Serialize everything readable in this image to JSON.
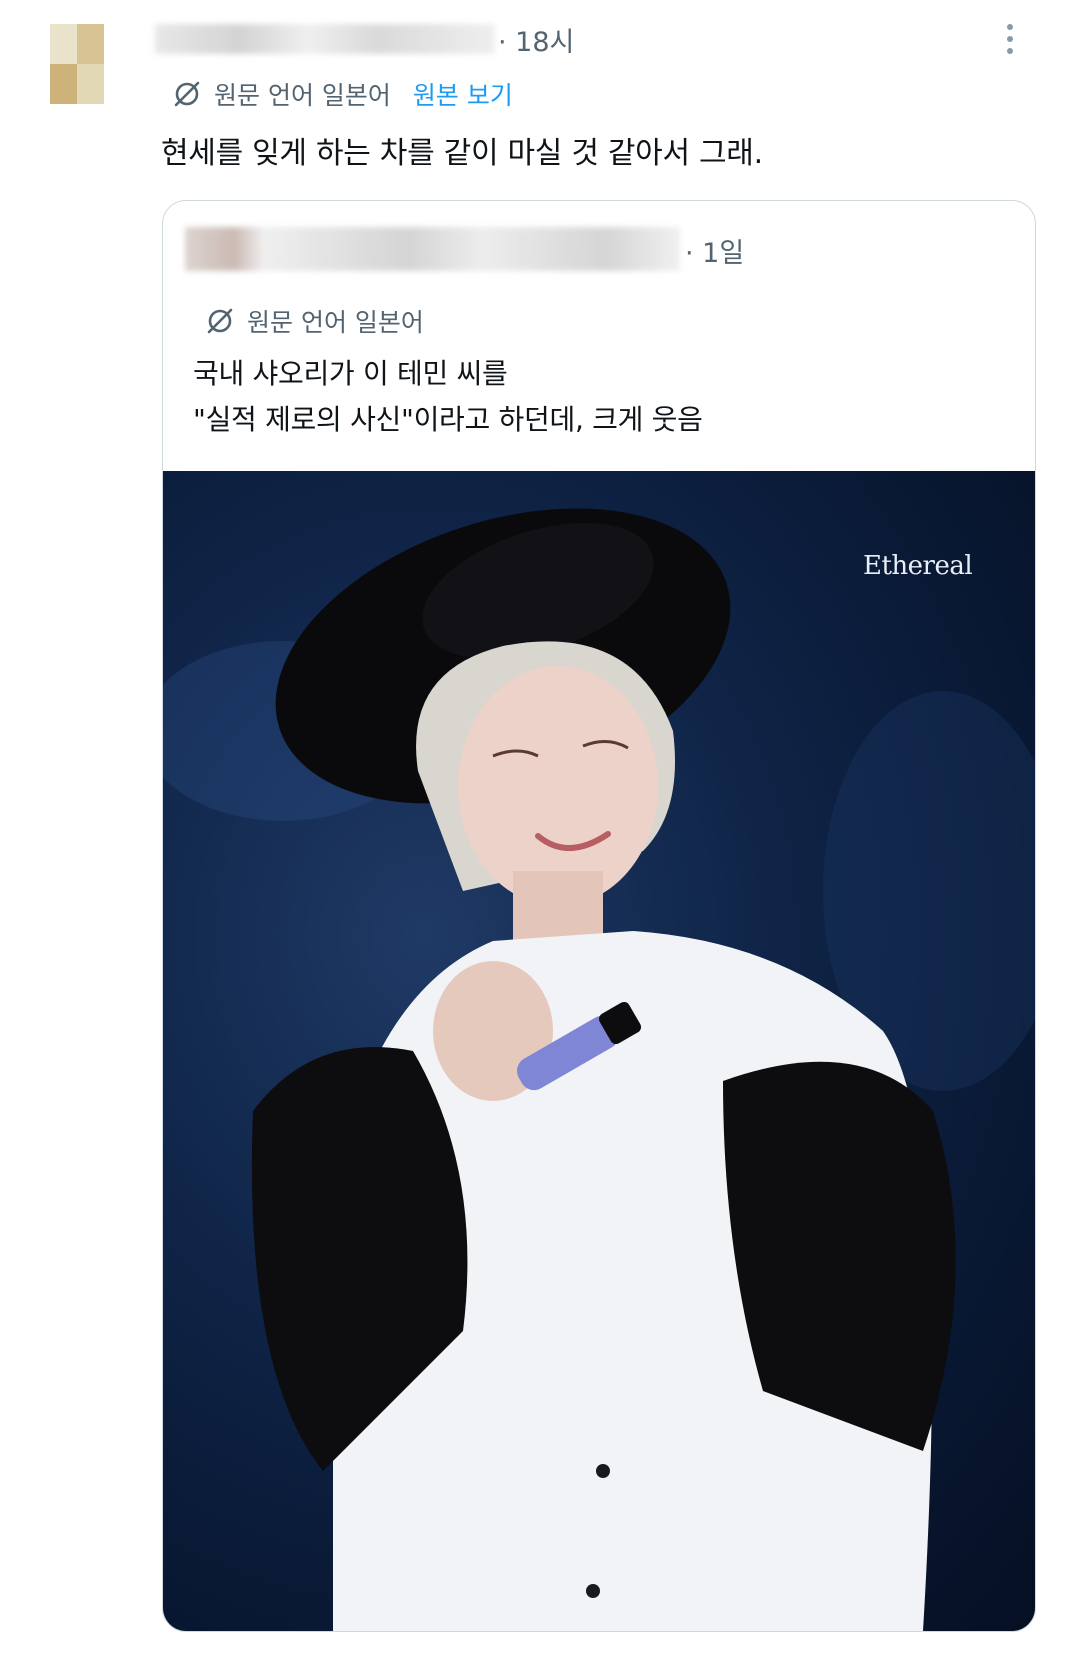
{
  "reply": {
    "time": "· 18시",
    "translation_label": "원문 언어 일본어",
    "show_original": "원본 보기",
    "text": "현세를 잊게 하는 차를 같이 마실 것 같아서 그래."
  },
  "quoted": {
    "time": "· 1일",
    "translation_label": "원문 언어 일본어",
    "text_lines": [
      "국내 샤오리가 이 테민 씨를",
      "\"실적 제로의 사신\"이라고 하던데, 크게 웃음"
    ],
    "media": {
      "watermark": "Ethereal"
    }
  },
  "icons": {
    "translate": "translate-icon",
    "more": "more-options-icon"
  },
  "colors": {
    "text": "#0f1419",
    "muted": "#536471",
    "link": "#1d9bf0",
    "border": "#cfd9de",
    "photo_bg": "#0b1b38"
  }
}
